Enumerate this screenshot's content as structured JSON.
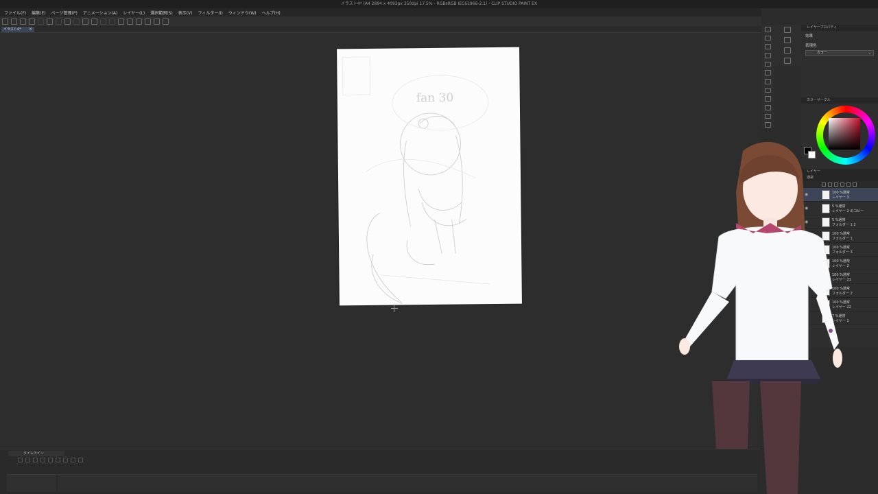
{
  "window": {
    "title": "イラスト4* (A4 2894 x 4093px 350dpi 17.5% - RGBsRGB IEC61966-2.1) - CLIP STUDIO PAINT EX"
  },
  "menu": [
    "ファイル(F)",
    "編集(E)",
    "ページ管理(P)",
    "アニメーション(A)",
    "レイヤー(L)",
    "選択範囲(S)",
    "表示(V)",
    "フィルター(I)",
    "ウィンドウ(W)",
    "ヘルプ(H)"
  ],
  "document_tab": {
    "label": "イラスト4*",
    "close": "×"
  },
  "canvas": {
    "sketch_text": "fan 30"
  },
  "right_panel": {
    "tool_property_title": "レイヤープロパティ",
    "effect_label": "効果",
    "display_color_label": "表現色",
    "display_color_value": "カラー",
    "color_wheel_title": "カラーサークル",
    "layer_panel_title": "レイヤー",
    "blend_mode": "通常"
  },
  "layers": [
    {
      "line1": "100 %通常",
      "line2": "レイヤー 3",
      "selected": true
    },
    {
      "line1": "5 %通常",
      "line2": "レイヤー 2 のコピー",
      "selected": false
    },
    {
      "line1": "5 %通常",
      "line2": "フォルダー 1 2",
      "selected": false
    },
    {
      "line1": "100 %通常",
      "line2": "フォルダー 1",
      "selected": false
    },
    {
      "line1": "100 %通常",
      "line2": "フォルダー 3",
      "selected": false
    },
    {
      "line1": "100 %通常",
      "line2": "レイヤー 2",
      "selected": false
    },
    {
      "line1": "100 %通常",
      "line2": "レイヤー 21",
      "selected": false
    },
    {
      "line1": "100 %通常",
      "line2": "フォルダー 2",
      "selected": false
    },
    {
      "line1": "100 %通常",
      "line2": "レイヤー 22",
      "selected": false
    },
    {
      "line1": "7 %通常",
      "line2": "レイヤー 1",
      "selected": false
    }
  ],
  "timeline": {
    "title": "タイムライン"
  },
  "colors": {
    "accent_selected": "#3c4658",
    "foreground": "#000000",
    "background": "#ffffff"
  }
}
